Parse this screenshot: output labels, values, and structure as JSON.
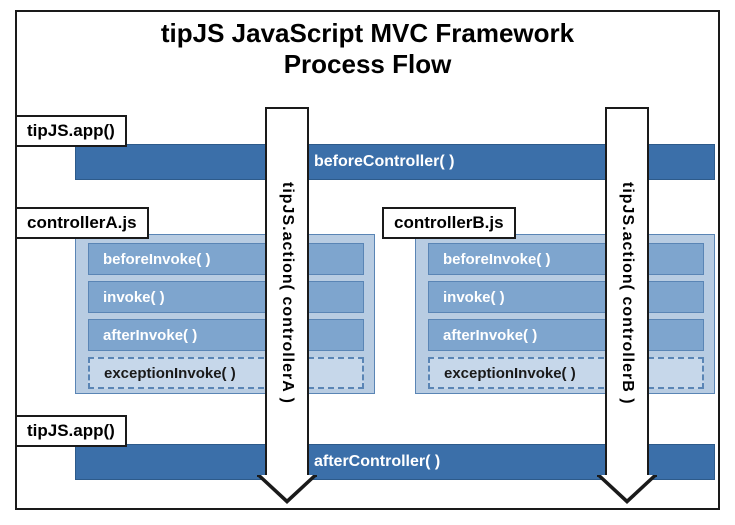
{
  "title_line1": "tipJS JavaScript MVC Framework",
  "title_line2": "Process Flow",
  "tags": {
    "app_top": "tipJS.app()",
    "controllerA": "controllerA.js",
    "controllerB": "controllerB.js",
    "app_bottom": "tipJS.app()"
  },
  "bands": {
    "before": "beforeController( )",
    "after": "afterController( )"
  },
  "rows": {
    "beforeInvoke": "beforeInvoke( )",
    "invoke": "invoke( )",
    "afterInvoke": "afterInvoke( )",
    "exceptionInvoke": "exceptionInvoke( )"
  },
  "arrows": {
    "a": "tipJS.action( controllerA )",
    "b": "tipJS.action( controllerB )"
  }
}
